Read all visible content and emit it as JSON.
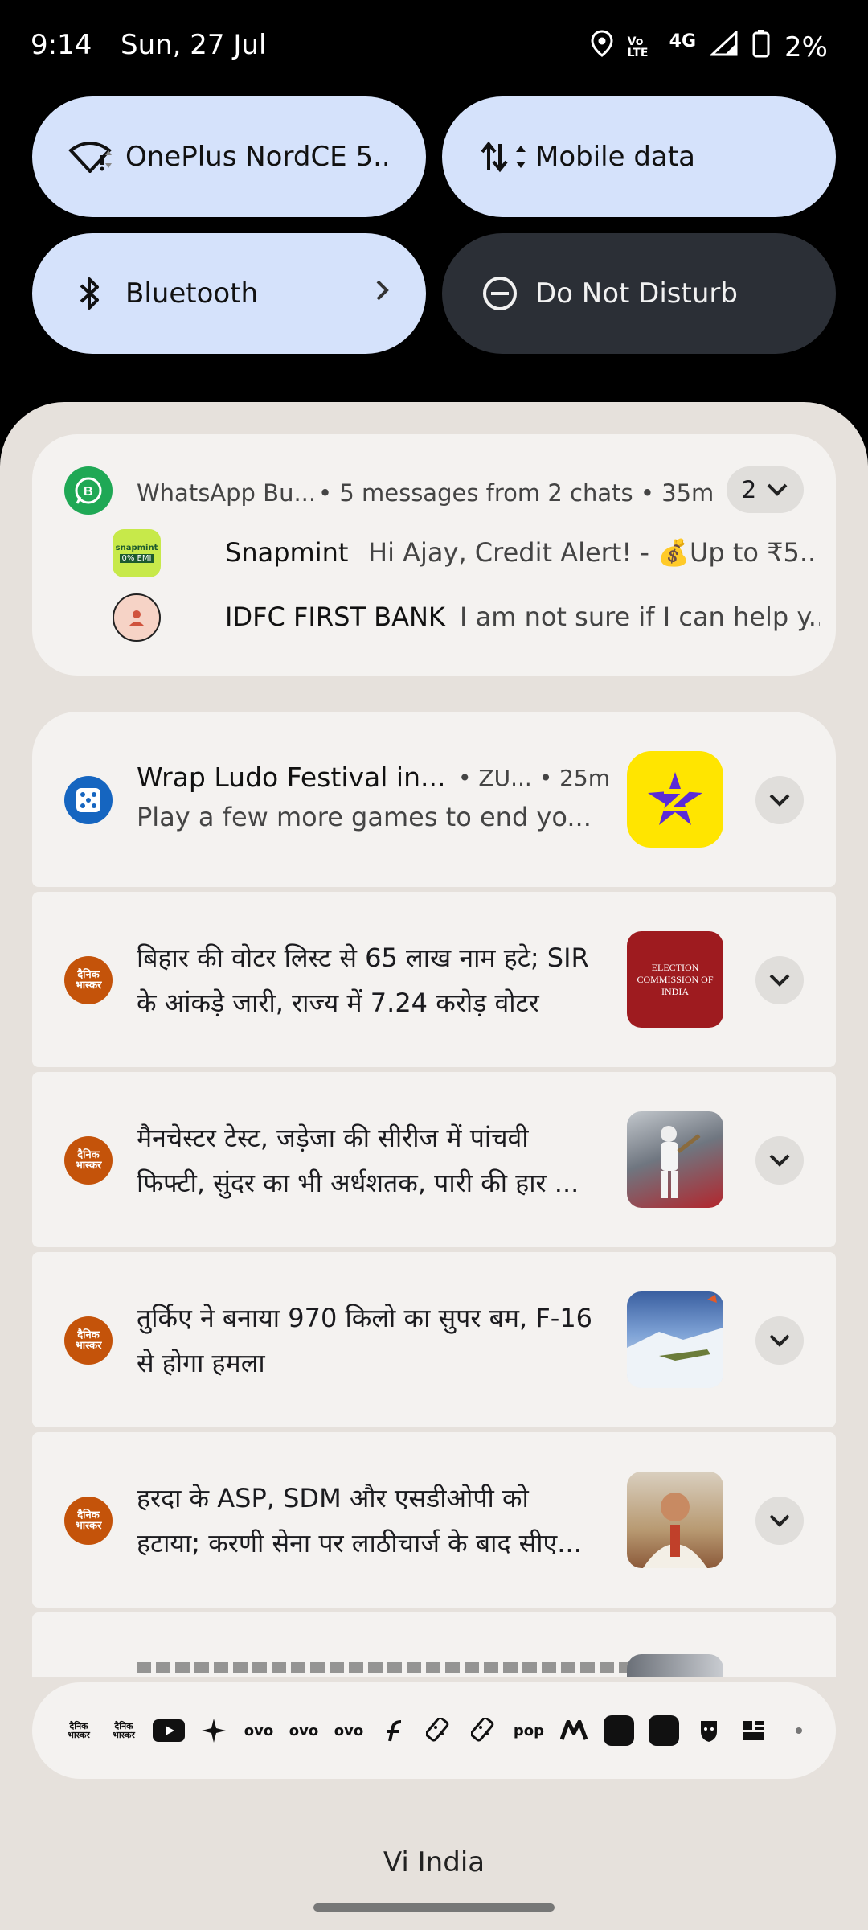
{
  "status_bar": {
    "time": "9:14",
    "date": "Sun, 27 Jul",
    "network_type": "4G",
    "battery": "2%",
    "volte_label": "Vo LTE"
  },
  "quick_tiles": {
    "wifi": "OnePlus NordCE 5..",
    "mobile_data": "Mobile data",
    "bluetooth": "Bluetooth",
    "dnd": "Do Not Disturb"
  },
  "whatsapp_group": {
    "app": "WhatsApp Bu...",
    "summary": "• 5 messages from 2 chats • 35m",
    "count": "2",
    "chats": [
      {
        "sender": "Snapmint",
        "message": "Hi Ajay,   Credit Alert! - 💰Up to ₹5..."
      },
      {
        "sender": "IDFC FIRST BANK",
        "message": "I am not sure if I can help y..."
      }
    ],
    "snapmint_badge": "snapmint",
    "snapmint_emi": "0% EMI"
  },
  "ludo": {
    "title": "Wrap Ludo Festival in...",
    "meta": "• ZU... • 25m",
    "text": "Play a few more games to end yo..."
  },
  "news": [
    {
      "line1": "बिहार की वोटर लिस्ट से 65 लाख नाम हटे; SIR",
      "line2": "के आंकड़े जारी, राज्य में 7.24 करोड़ वोटर"
    },
    {
      "line1": "मैनचेस्टर टेस्ट, जड़ेजा की सीरीज में पांचवी",
      "line2": "फिफ्टी, सुंदर का भी अर्धशतक, पारी की हार ..."
    },
    {
      "line1": "तुर्किए ने बनाया 970 किलो का सुपर बम, F-16",
      "line2": "से होगा हमला"
    },
    {
      "line1": "हरदा के ASP, SDM और एसडीओपी को",
      "line2": "हटाया; करणी सेना पर लाठीचार्ज के बाद सीए..."
    }
  ],
  "bhaskar_logo": "दैनिक भास्कर",
  "thumb1_text": "ELECTION COMMISSION OF INDIA",
  "tray_labels": {
    "ovo": "ovo",
    "pop": "pop"
  },
  "carrier": "Vi India"
}
